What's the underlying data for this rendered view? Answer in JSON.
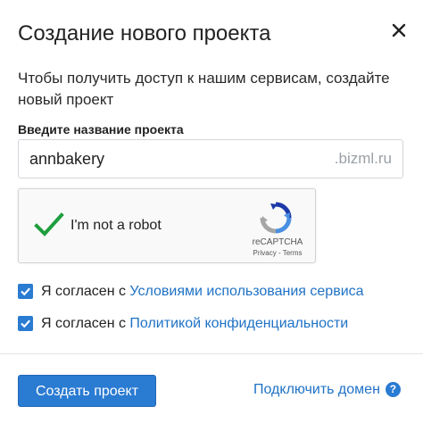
{
  "dialog": {
    "title": "Создание нового проекта",
    "intro": "Чтобы получить доступ к нашим сервисам, создайте новый проект"
  },
  "project_field": {
    "label": "Введите название проекта",
    "value": "annbakery",
    "suffix": ".bizml.ru"
  },
  "recaptcha": {
    "label": "I'm not a robot",
    "brand": "reCAPTCHA",
    "links": "Privacy - Terms",
    "checked": true
  },
  "agreements": [
    {
      "prefix": "Я согласен с ",
      "link": "Условиями использования сервиса",
      "checked": true
    },
    {
      "prefix": "Я согласен с ",
      "link": "Политикой конфиденциальности",
      "checked": true
    }
  ],
  "footer": {
    "create_button": "Создать проект",
    "connect_domain_link": "Подключить домен",
    "help_glyph": "?"
  },
  "colors": {
    "accent": "#2a7bd2",
    "link": "#1f72c6",
    "recaptcha_check": "#1e9e3e"
  },
  "icons": {
    "close": "close-icon",
    "recaptcha_check": "checkmark-icon",
    "recaptcha_logo": "recaptcha-logo-icon",
    "checkbox": "checkbox-checked-icon",
    "help": "help-icon"
  }
}
